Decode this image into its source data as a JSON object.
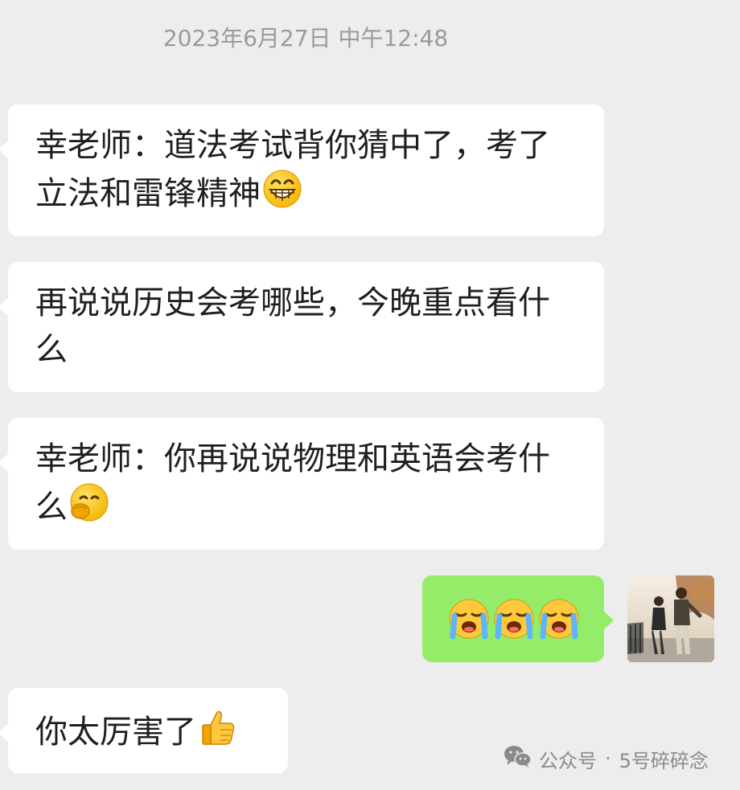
{
  "chat": {
    "timestamp": "2023年6月27日 中午12:48",
    "messages": [
      {
        "side": "left",
        "text": "幸老师：道法考试背你猜中了，考了立法和雷锋精神",
        "emoji": "grin-emoji"
      },
      {
        "side": "left",
        "text": "再说说历史会考哪些，今晚重点看什么"
      },
      {
        "side": "left",
        "text": "幸老师：你再说说物理和英语会考什么",
        "emoji": "giggle-emoji"
      },
      {
        "side": "right",
        "emojis": [
          "loudly-crying-emoji",
          "loudly-crying-emoji",
          "loudly-crying-emoji"
        ]
      },
      {
        "side": "left",
        "text": "你太厉害了",
        "emoji": "thumbs-up-emoji"
      }
    ]
  },
  "watermark": {
    "label": "公众号",
    "separator": "·",
    "account": "5号碎碎念",
    "icon": "wechat-icon"
  },
  "colors": {
    "background": "#ededed",
    "incoming_bubble": "#ffffff",
    "outgoing_bubble": "#95ec69",
    "timestamp_text": "#9a9a9a"
  }
}
